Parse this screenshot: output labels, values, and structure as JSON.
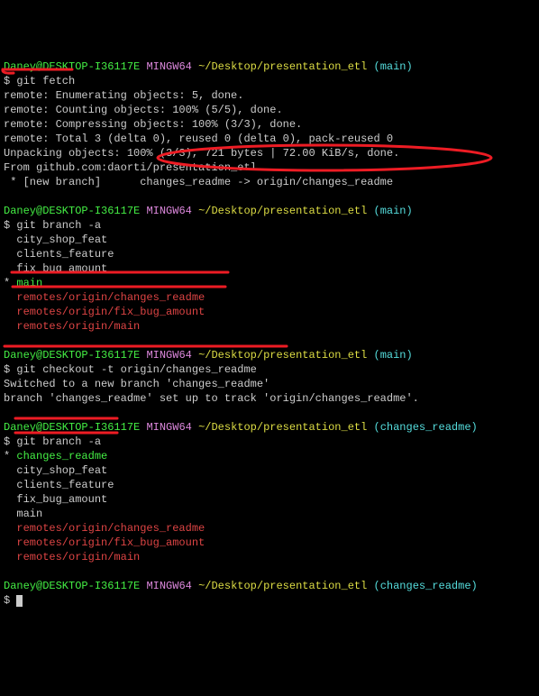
{
  "prompt1": {
    "user": "Daney@DESKTOP-I36117E",
    "sys": "MINGW64",
    "path": "~/Desktop/presentation_etl",
    "branch": "(main)"
  },
  "cmd1": "$ git fetch",
  "fetch": {
    "l1": "remote: Enumerating objects: 5, done.",
    "l2": "remote: Counting objects: 100% (5/5), done.",
    "l3": "remote: Compressing objects: 100% (3/3), done.",
    "l4": "remote: Total 3 (delta 0), reused 0 (delta 0), pack-reused 0",
    "l5": "Unpacking objects: 100% (3/3), 721 bytes | 72.00 KiB/s, done.",
    "l6": "From github.com:daorti/presentation_etl",
    "l7": " * [new branch]      changes_readme -> origin/changes_readme"
  },
  "prompt2": {
    "user": "Daney@DESKTOP-I36117E",
    "sys": "MINGW64",
    "path": "~/Desktop/presentation_etl",
    "branch": "(main)"
  },
  "cmd2": "$ git branch -a",
  "branches1": {
    "b1": "  city_shop_feat",
    "b2": "  clients_feature",
    "b3": "  fix_bug_amount",
    "b4a": "* ",
    "b4b": "main",
    "r1": "  remotes/origin/changes_readme",
    "r2": "  remotes/origin/fix_bug_amount",
    "r3": "  remotes/origin/main"
  },
  "prompt3": {
    "user": "Daney@DESKTOP-I36117E",
    "sys": "MINGW64",
    "path": "~/Desktop/presentation_etl",
    "branch": "(main)"
  },
  "cmd3": "$ git checkout -t origin/changes_readme",
  "checkout": {
    "l1": "Switched to a new branch 'changes_readme'",
    "l2": "branch 'changes_readme' set up to track 'origin/changes_readme'."
  },
  "prompt4": {
    "user": "Daney@DESKTOP-I36117E",
    "sys": "MINGW64",
    "path": "~/Desktop/presentation_etl",
    "branch": "(changes_readme)"
  },
  "cmd4": "$ git branch -a",
  "branches2": {
    "b1a": "* ",
    "b1b": "changes_readme",
    "b2": "  city_shop_feat",
    "b3": "  clients_feature",
    "b4": "  fix_bug_amount",
    "b5": "  main",
    "r1": "  remotes/origin/changes_readme",
    "r2": "  remotes/origin/fix_bug_amount",
    "r3": "  remotes/origin/main"
  },
  "prompt5": {
    "user": "Daney@DESKTOP-I36117E",
    "sys": "MINGW64",
    "path": "~/Desktop/presentation_etl",
    "branch": "(changes_readme)"
  },
  "cmd5": "$ "
}
